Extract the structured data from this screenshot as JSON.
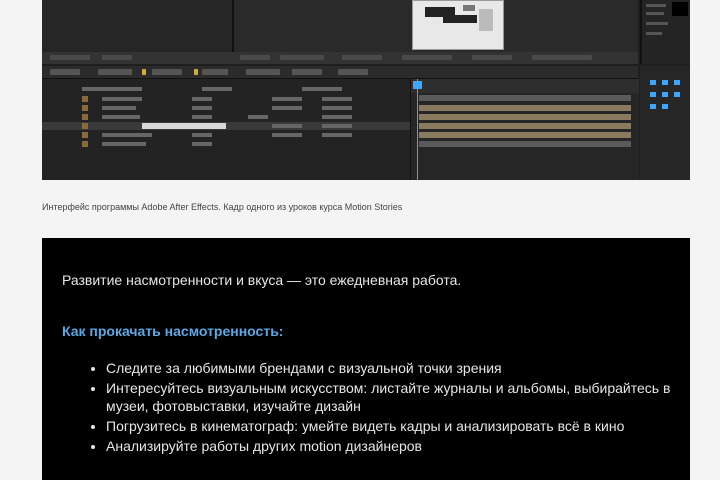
{
  "screenshot": {
    "colors": {
      "background": "#1f1f1f",
      "accent": "#3ea6ff",
      "clip": "#8a7b5e",
      "tab_active": "#cfae3c"
    }
  },
  "caption": "Интерфейс программы Adobe After Effects. Кадр одного из уроков курса Motion Stories",
  "box": {
    "lead": "Развитие насмотренности и вкуса — это ежедневная работа.",
    "heading": "Как прокачать насмотренность:",
    "items": [
      "Следите за любимыми брендами с визуальной точки зрения",
      "Интересуйтесь визуальным искусством: листайте журналы и альбомы, выбирайтесь в музеи, фотовыставки, изучайте дизайн",
      "Погрузитесь в кинематограф: умейте видеть кадры и анализировать всё в кино",
      "Анализируйте работы других motion дизайнеров"
    ],
    "colors": {
      "background": "#000000",
      "text": "#e6e6e6",
      "heading": "#5aa9e6"
    }
  }
}
